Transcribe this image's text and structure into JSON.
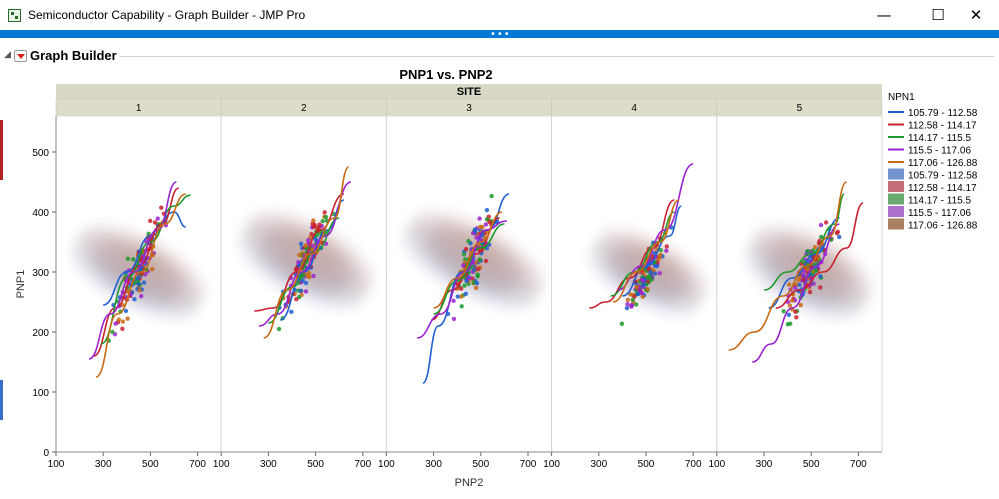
{
  "window": {
    "title": "Semiconductor Capability - Graph Builder - JMP Pro",
    "minimize_glyph": "—",
    "maximize_glyph": "☐",
    "close_glyph": "✕",
    "splitter_dots": "•••"
  },
  "report": {
    "outline_title": "Graph Builder",
    "disclosure_glyph": "◢"
  },
  "icons": {
    "app": "jmp-table-icon",
    "red_triangle": "red-triangle-menu-icon",
    "disclosure": "disclosure-triangle-icon"
  },
  "colors": {
    "accent": "#0078d7",
    "facet_header": "#dcdcc8",
    "site_header": "#d8d8c4"
  },
  "chart_data": {
    "type": "scatter",
    "title": "PNP1 vs. PNP2",
    "facet_label": "SITE",
    "xlabel": "PNP2",
    "ylabel": "PNP1",
    "xlim": [
      100,
      800
    ],
    "ylim": [
      0,
      560
    ],
    "xticks": [
      100,
      300,
      500,
      700
    ],
    "yticks": [
      0,
      100,
      200,
      300,
      400,
      500
    ],
    "grid": false,
    "legend_position": "right",
    "legend_title": "NPN1",
    "facets": [
      "1",
      "2",
      "3",
      "4",
      "5"
    ],
    "series": [
      {
        "name": "105.79 - 112.58",
        "color": "#1f5fd0",
        "density_color": "#5b7fc8"
      },
      {
        "name": "112.58 - 114.17",
        "color": "#c8202f",
        "density_color": "#b85560"
      },
      {
        "name": "114.17 - 115.5",
        "color": "#1e9a2e",
        "density_color": "#4f9a57"
      },
      {
        "name": "115.5 - 117.06",
        "color": "#9b22d0",
        "density_color": "#9b57c2"
      },
      {
        "name": "117.06 - 126.88",
        "color": "#c76a10",
        "density_color": "#9a6a48"
      }
    ],
    "legend_entries": [
      {
        "label": "105.79 - 112.58",
        "kind": "line",
        "color": "#1f5fd0"
      },
      {
        "label": "112.58 - 114.17",
        "kind": "line",
        "color": "#c8202f"
      },
      {
        "label": "114.17 - 115.5",
        "kind": "line",
        "color": "#1e9a2e"
      },
      {
        "label": "115.5 - 117.06",
        "kind": "line",
        "color": "#9b22d0"
      },
      {
        "label": "117.06 - 126.88",
        "kind": "line",
        "color": "#c76a10"
      },
      {
        "label": "105.79 - 112.58",
        "kind": "density",
        "color": "#5b7fc8"
      },
      {
        "label": "112.58 - 114.17",
        "kind": "density",
        "color": "#b85560"
      },
      {
        "label": "114.17 - 115.5",
        "kind": "density",
        "color": "#4f9a57"
      },
      {
        "label": "115.5 - 117.06",
        "kind": "density",
        "color": "#9b57c2"
      },
      {
        "label": "117.06 - 126.88",
        "kind": "density",
        "color": "#9a6a48"
      }
    ],
    "panels": [
      {
        "site": "1",
        "center": [
          450,
          300
        ],
        "spread": [
          110,
          80
        ],
        "slope": 1.2,
        "n": 140,
        "curves": [
          {
            "series": 0,
            "points": [
              [
                300,
                245
              ],
              [
                400,
                300
              ],
              [
                500,
                360
              ],
              [
                600,
                400
              ],
              [
                650,
                375
              ]
            ]
          },
          {
            "series": 1,
            "points": [
              [
                260,
                160
              ],
              [
                350,
                240
              ],
              [
                450,
                310
              ],
              [
                550,
                380
              ],
              [
                620,
                440
              ]
            ]
          },
          {
            "series": 2,
            "points": [
              [
                290,
                180
              ],
              [
                400,
                290
              ],
              [
                500,
                350
              ],
              [
                600,
                410
              ],
              [
                670,
                428
              ]
            ]
          },
          {
            "series": 3,
            "points": [
              [
                240,
                155
              ],
              [
                330,
                230
              ],
              [
                430,
                300
              ],
              [
                530,
                370
              ],
              [
                610,
                450
              ]
            ]
          },
          {
            "series": 4,
            "points": [
              [
                270,
                125
              ],
              [
                360,
                230
              ],
              [
                460,
                300
              ],
              [
                560,
                380
              ],
              [
                650,
                430
              ]
            ]
          }
        ]
      },
      {
        "site": "2",
        "center": [
          460,
          320
        ],
        "spread": [
          120,
          80
        ],
        "slope": 1.1,
        "n": 140,
        "curves": [
          {
            "series": 0,
            "points": [
              [
                350,
                220
              ],
              [
                450,
                300
              ],
              [
                550,
                370
              ],
              [
                620,
                420
              ]
            ]
          },
          {
            "series": 1,
            "points": [
              [
                240,
                235
              ],
              [
                320,
                240
              ],
              [
                420,
                300
              ],
              [
                520,
                370
              ],
              [
                620,
                430
              ]
            ]
          },
          {
            "series": 2,
            "points": [
              [
                300,
                215
              ],
              [
                400,
                275
              ],
              [
                500,
                335
              ],
              [
                600,
                390
              ]
            ]
          },
          {
            "series": 3,
            "points": [
              [
                260,
                210
              ],
              [
                340,
                230
              ],
              [
                440,
                300
              ],
              [
                540,
                360
              ],
              [
                650,
                450
              ]
            ]
          },
          {
            "series": 4,
            "points": [
              [
                280,
                190
              ],
              [
                380,
                270
              ],
              [
                480,
                330
              ],
              [
                580,
                390
              ],
              [
                640,
                475
              ]
            ]
          }
        ]
      },
      {
        "site": "3",
        "center": [
          470,
          320
        ],
        "spread": [
          110,
          85
        ],
        "slope": 1.1,
        "n": 140,
        "curves": [
          {
            "series": 0,
            "points": [
              [
                255,
                115
              ],
              [
                320,
                210
              ],
              [
                420,
                300
              ],
              [
                530,
                370
              ],
              [
                620,
                430
              ]
            ]
          },
          {
            "series": 1,
            "points": [
              [
                290,
                220
              ],
              [
                380,
                270
              ],
              [
                480,
                330
              ],
              [
                580,
                390
              ]
            ]
          },
          {
            "series": 2,
            "points": [
              [
                300,
                230
              ],
              [
                400,
                285
              ],
              [
                500,
                340
              ],
              [
                600,
                380
              ]
            ]
          },
          {
            "series": 3,
            "points": [
              [
                230,
                190
              ],
              [
                330,
                230
              ],
              [
                430,
                300
              ],
              [
                520,
                370
              ],
              [
                610,
                385
              ]
            ]
          },
          {
            "series": 4,
            "points": [
              [
                300,
                240
              ],
              [
                400,
                290
              ],
              [
                500,
                350
              ],
              [
                590,
                400
              ]
            ]
          }
        ]
      },
      {
        "site": "4",
        "center": [
          510,
          300
        ],
        "spread": [
          100,
          70
        ],
        "slope": 1.0,
        "n": 130,
        "curves": [
          {
            "series": 0,
            "points": [
              [
                400,
                260
              ],
              [
                500,
                310
              ],
              [
                600,
                360
              ],
              [
                650,
                410
              ]
            ]
          },
          {
            "series": 1,
            "points": [
              [
                260,
                240
              ],
              [
                330,
                250
              ],
              [
                430,
                290
              ],
              [
                530,
                340
              ],
              [
                620,
                420
              ]
            ]
          },
          {
            "series": 2,
            "points": [
              [
                350,
                260
              ],
              [
                450,
                300
              ],
              [
                550,
                350
              ],
              [
                620,
                400
              ]
            ]
          },
          {
            "series": 3,
            "points": [
              [
                380,
                270
              ],
              [
                480,
                310
              ],
              [
                580,
                370
              ],
              [
                700,
                480
              ]
            ]
          },
          {
            "series": 4,
            "points": [
              [
                360,
                250
              ],
              [
                460,
                300
              ],
              [
                560,
                350
              ],
              [
                640,
                420
              ]
            ]
          }
        ]
      },
      {
        "site": "5",
        "center": [
          490,
          300
        ],
        "spread": [
          120,
          75
        ],
        "slope": 1.0,
        "n": 150,
        "curves": [
          {
            "series": 0,
            "points": [
              [
                320,
                240
              ],
              [
                420,
                290
              ],
              [
                520,
                330
              ],
              [
                620,
                390
              ]
            ]
          },
          {
            "series": 1,
            "points": [
              [
                350,
                240
              ],
              [
                450,
                270
              ],
              [
                550,
                300
              ],
              [
                650,
                340
              ],
              [
                720,
                415
              ]
            ]
          },
          {
            "series": 2,
            "points": [
              [
                300,
                270
              ],
              [
                400,
                300
              ],
              [
                500,
                330
              ],
              [
                600,
                380
              ],
              [
                640,
                430
              ]
            ]
          },
          {
            "series": 3,
            "points": [
              [
                250,
                150
              ],
              [
                330,
                180
              ],
              [
                420,
                240
              ],
              [
                520,
                310
              ],
              [
                620,
                380
              ]
            ]
          },
          {
            "series": 4,
            "points": [
              [
                150,
                170
              ],
              [
                260,
                200
              ],
              [
                380,
                260
              ],
              [
                480,
                310
              ],
              [
                580,
                360
              ],
              [
                650,
                450
              ]
            ]
          }
        ]
      }
    ]
  }
}
